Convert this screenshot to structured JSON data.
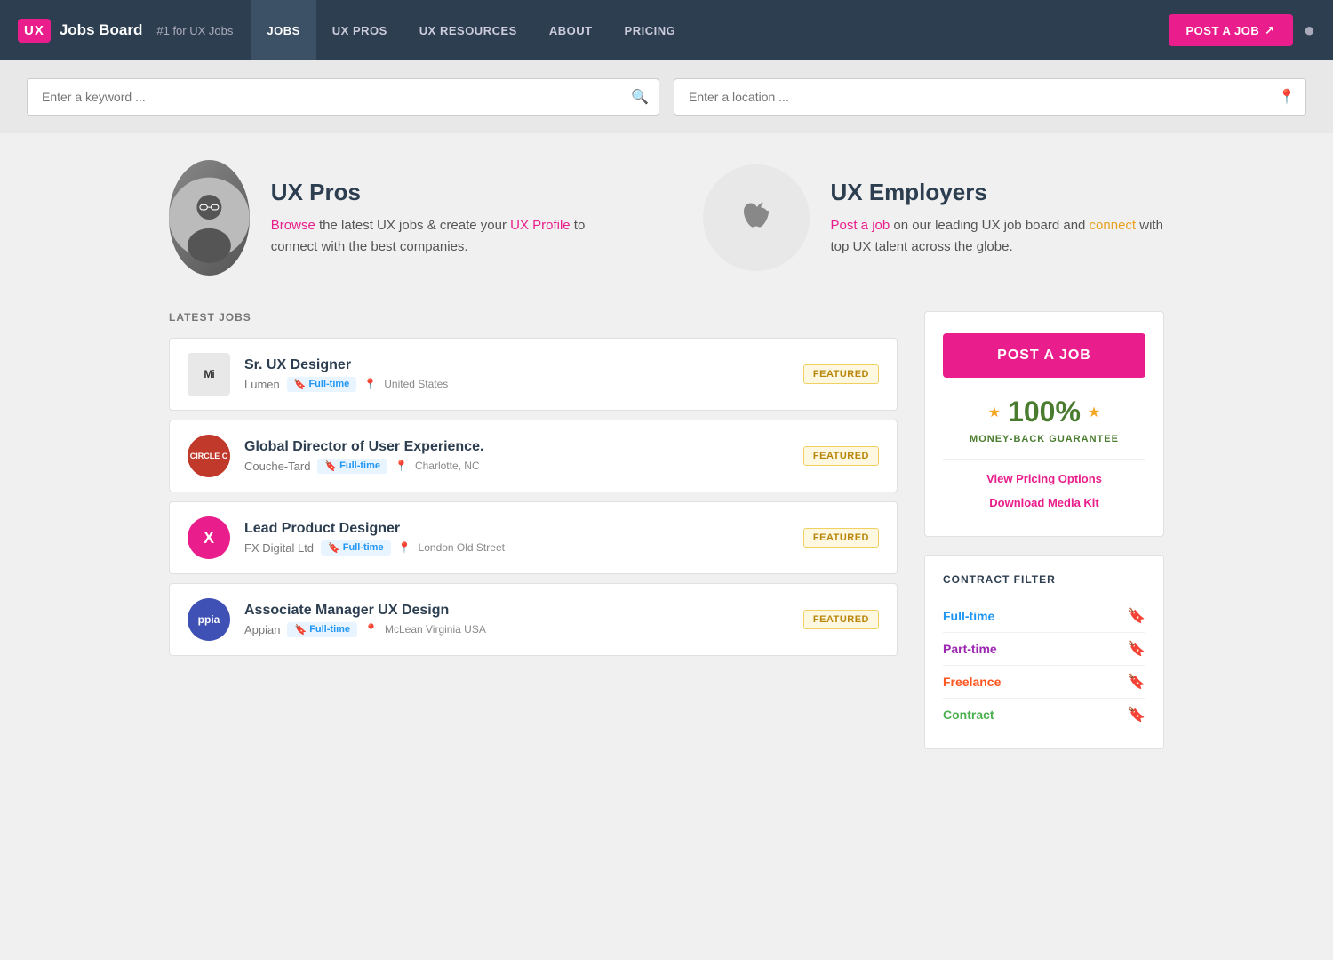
{
  "navbar": {
    "logo_text": "UX",
    "brand_name": "Jobs Board",
    "tagline": "#1 for UX Jobs",
    "nav_items": [
      {
        "label": "JOBS",
        "active": true
      },
      {
        "label": "UX PROS",
        "active": false
      },
      {
        "label": "UX RESOURCES",
        "active": false
      },
      {
        "label": "ABOUT",
        "active": false
      },
      {
        "label": "PRICING",
        "active": false
      }
    ],
    "post_job_label": "POST A JOB",
    "post_job_icon": "↗"
  },
  "search": {
    "keyword_placeholder": "Enter a keyword ...",
    "location_placeholder": "Enter a location ..."
  },
  "ux_pros": {
    "heading": "UX Pros",
    "browse_text": "Browse",
    "description_1": " the latest UX jobs & create your ",
    "profile_link": "UX Profile",
    "description_2": " to connect with the best companies."
  },
  "ux_employers": {
    "heading": "UX Employers",
    "post_link": "Post a job",
    "description_1": " on our leading UX job board and ",
    "connect_link": "connect",
    "description_2": " with top UX talent across the globe."
  },
  "latest_jobs": {
    "label": "LATEST JOBS",
    "jobs": [
      {
        "id": 1,
        "title": "Sr. UX Designer",
        "company": "Lumen",
        "type": "Full-time",
        "location": "United States",
        "featured": true,
        "logo_text": "Mi",
        "logo_bg": "#e8e8e8",
        "logo_color": "#333"
      },
      {
        "id": 2,
        "title": "Global Director of User Experience.",
        "company": "Couche-Tard",
        "type": "Full-time",
        "location": "Charlotte, NC",
        "featured": true,
        "logo_text": "CIRCLE C",
        "logo_bg": "#c0392b",
        "logo_color": "#fff"
      },
      {
        "id": 3,
        "title": "Lead Product Designer",
        "company": "FX Digital Ltd",
        "type": "Full-time",
        "location": "London Old Street",
        "featured": true,
        "logo_text": "X",
        "logo_bg": "#e91e8c",
        "logo_color": "#fff"
      },
      {
        "id": 4,
        "title": "Associate Manager UX Design",
        "company": "Appian",
        "type": "Full-time",
        "location": "McLean Virginia USA",
        "featured": true,
        "logo_text": "ppia",
        "logo_bg": "#3f51b5",
        "logo_color": "#fff"
      }
    ]
  },
  "sidebar": {
    "post_job_label": "POST A JOB",
    "guarantee_pct": "100%",
    "guarantee_label": "MONEY-BACK GUARANTEE",
    "star_left": "★",
    "star_right": "★",
    "view_pricing_label": "View Pricing Options",
    "download_media_label": "Download Media Kit",
    "contract_filter_title": "CONTRACT FILTER",
    "contract_filters": [
      {
        "label": "Full-time",
        "color": "ft-color"
      },
      {
        "label": "Part-time",
        "color": "pt-color"
      },
      {
        "label": "Freelance",
        "color": "fl-color"
      },
      {
        "label": "Contract",
        "color": "ct-color"
      }
    ]
  }
}
